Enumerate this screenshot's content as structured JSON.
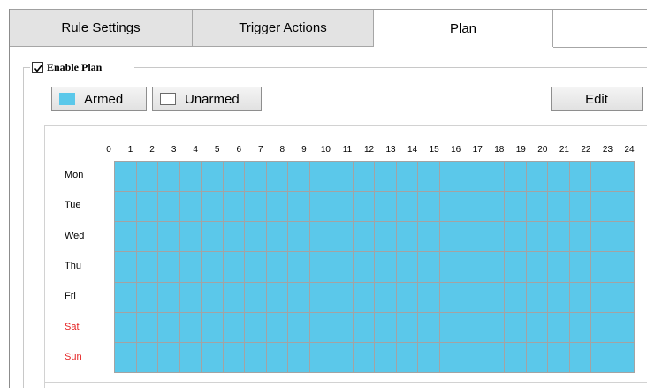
{
  "tabs": [
    {
      "label": "Rule Settings",
      "active": false
    },
    {
      "label": "Trigger Actions",
      "active": false
    },
    {
      "label": "Plan",
      "active": true
    }
  ],
  "plan": {
    "enable_label": "Enable Plan",
    "enabled": true
  },
  "mode_buttons": {
    "armed_label": "Armed",
    "unarmed_label": "Unarmed",
    "edit_label": "Edit"
  },
  "colors": {
    "armed": "#5bc8ea",
    "unarmed": "#ffffff",
    "weekend_label": "#e52222"
  },
  "schedule": {
    "hours": [
      "0",
      "1",
      "2",
      "3",
      "4",
      "5",
      "6",
      "7",
      "8",
      "9",
      "10",
      "11",
      "12",
      "13",
      "14",
      "15",
      "16",
      "17",
      "18",
      "19",
      "20",
      "21",
      "22",
      "23",
      "24"
    ],
    "days": [
      {
        "label": "Mon",
        "weekend": false,
        "armed_hours": [
          0,
          1,
          2,
          3,
          4,
          5,
          6,
          7,
          8,
          9,
          10,
          11,
          12,
          13,
          14,
          15,
          16,
          17,
          18,
          19,
          20,
          21,
          22,
          23
        ]
      },
      {
        "label": "Tue",
        "weekend": false,
        "armed_hours": [
          0,
          1,
          2,
          3,
          4,
          5,
          6,
          7,
          8,
          9,
          10,
          11,
          12,
          13,
          14,
          15,
          16,
          17,
          18,
          19,
          20,
          21,
          22,
          23
        ]
      },
      {
        "label": "Wed",
        "weekend": false,
        "armed_hours": [
          0,
          1,
          2,
          3,
          4,
          5,
          6,
          7,
          8,
          9,
          10,
          11,
          12,
          13,
          14,
          15,
          16,
          17,
          18,
          19,
          20,
          21,
          22,
          23
        ]
      },
      {
        "label": "Thu",
        "weekend": false,
        "armed_hours": [
          0,
          1,
          2,
          3,
          4,
          5,
          6,
          7,
          8,
          9,
          10,
          11,
          12,
          13,
          14,
          15,
          16,
          17,
          18,
          19,
          20,
          21,
          22,
          23
        ]
      },
      {
        "label": "Fri",
        "weekend": false,
        "armed_hours": [
          0,
          1,
          2,
          3,
          4,
          5,
          6,
          7,
          8,
          9,
          10,
          11,
          12,
          13,
          14,
          15,
          16,
          17,
          18,
          19,
          20,
          21,
          22,
          23
        ]
      },
      {
        "label": "Sat",
        "weekend": true,
        "armed_hours": [
          0,
          1,
          2,
          3,
          4,
          5,
          6,
          7,
          8,
          9,
          10,
          11,
          12,
          13,
          14,
          15,
          16,
          17,
          18,
          19,
          20,
          21,
          22,
          23
        ]
      },
      {
        "label": "Sun",
        "weekend": true,
        "armed_hours": [
          0,
          1,
          2,
          3,
          4,
          5,
          6,
          7,
          8,
          9,
          10,
          11,
          12,
          13,
          14,
          15,
          16,
          17,
          18,
          19,
          20,
          21,
          22,
          23
        ]
      }
    ]
  }
}
